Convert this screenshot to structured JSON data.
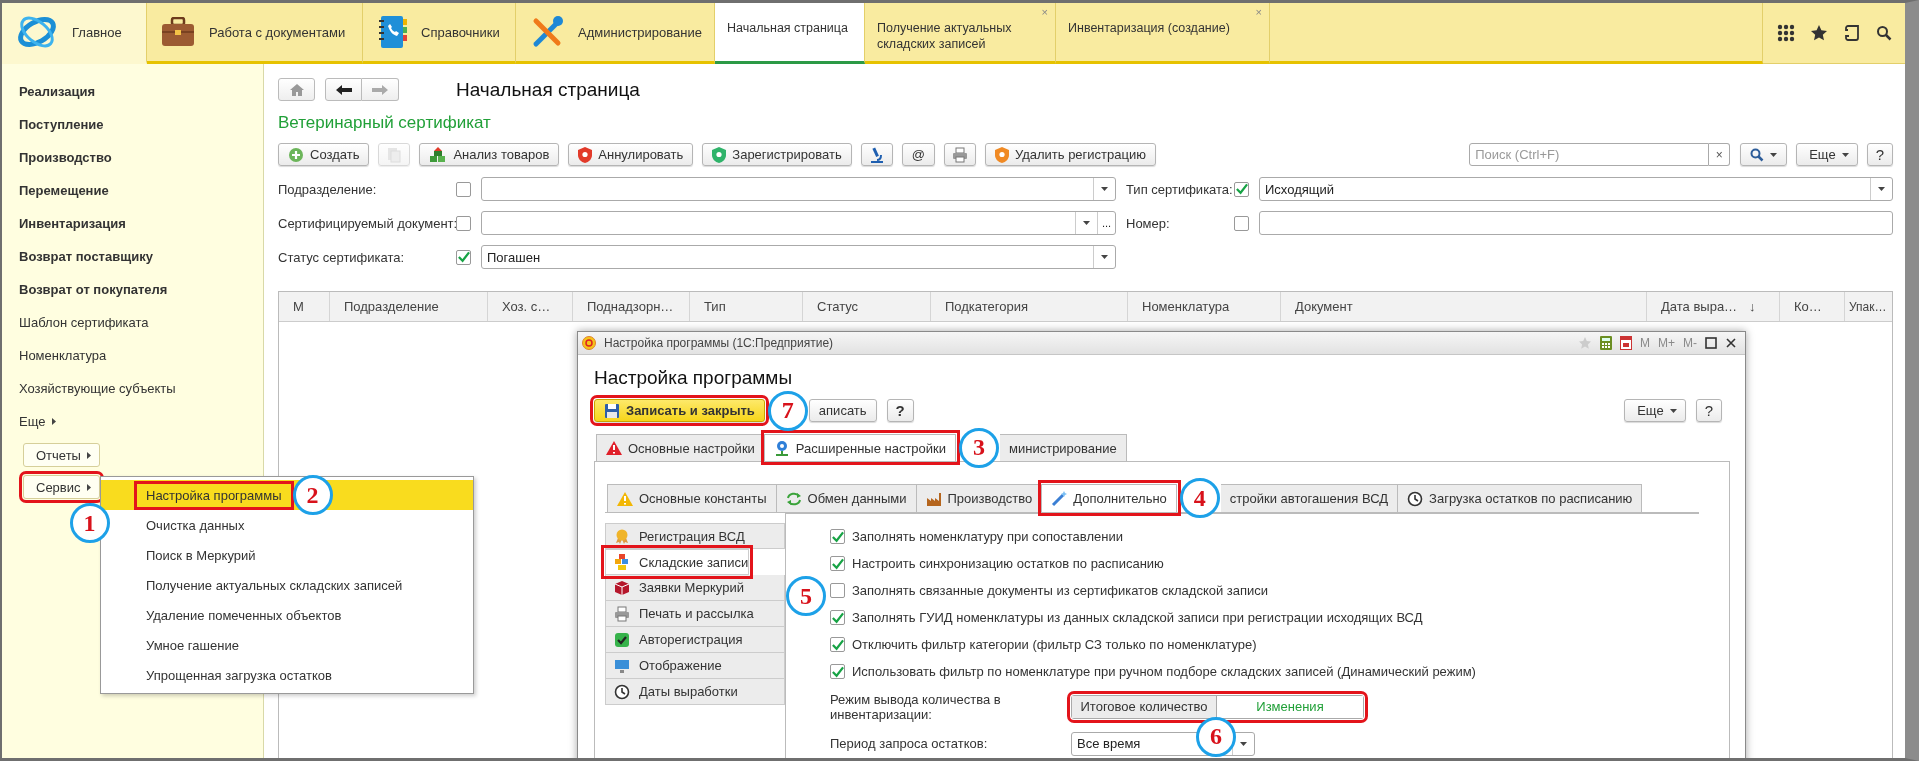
{
  "top_bar": {
    "sections": [
      {
        "label": "Главное",
        "selected": true
      },
      {
        "label": "Работа с документами",
        "selected": false
      },
      {
        "label": "Справочники",
        "selected": false
      },
      {
        "label": "Администрирование",
        "selected": false
      }
    ],
    "tabs": [
      {
        "label": "Начальная страница",
        "selected": true
      },
      {
        "label": "Получение актуальных складских записей",
        "selected": false,
        "close": "×"
      },
      {
        "label": "Инвентаризация (создание)",
        "selected": false,
        "close": "×"
      }
    ]
  },
  "sidebar": {
    "items": [
      {
        "kind": "section",
        "label": "Реализация"
      },
      {
        "kind": "section",
        "label": "Поступление"
      },
      {
        "kind": "section",
        "label": "Производство"
      },
      {
        "kind": "section",
        "label": "Перемещение"
      },
      {
        "kind": "section",
        "label": "Инвентаризация"
      },
      {
        "kind": "section",
        "label": "Возврат поставщику"
      },
      {
        "kind": "section",
        "label": "Возврат от покупателя"
      },
      {
        "kind": "link",
        "label": "Шаблон сертификата"
      },
      {
        "kind": "link",
        "label": "Номенклатура"
      },
      {
        "kind": "link",
        "label": "Хозяйствующие субъекты"
      },
      {
        "kind": "more",
        "label": "Еще"
      },
      {
        "kind": "button",
        "label": "Отчеты"
      },
      {
        "kind": "button",
        "label": "Сервис",
        "callout": "1"
      }
    ]
  },
  "service_menu": {
    "items": [
      {
        "label": "Настройка программы",
        "selected": true,
        "callout": "2"
      },
      {
        "label": "Очистка данных",
        "selected": false
      },
      {
        "label": "Поиск в Меркурий",
        "selected": false
      },
      {
        "label": "Получение актуальных складских записей",
        "selected": false
      },
      {
        "label": "Удаление помеченных объектов",
        "selected": false
      },
      {
        "label": "Умное гашение",
        "selected": false
      },
      {
        "label": "Упрощенная загрузка остатков",
        "selected": false
      }
    ]
  },
  "page": {
    "title": "Начальная страница",
    "form_title": "Ветеринарный сертификат",
    "toolbar": [
      {
        "kind": "button",
        "label": "Создать",
        "disabled": false
      },
      {
        "kind": "icon",
        "disabled": true
      },
      {
        "kind": "button",
        "label": "Анализ товаров",
        "disabled": false
      },
      {
        "kind": "button",
        "label": "Аннулировать",
        "disabled": false
      },
      {
        "kind": "button",
        "label": "Зарегистрировать",
        "disabled": false
      },
      {
        "kind": "icon",
        "disabled": false
      },
      {
        "kind": "text",
        "label": "@",
        "disabled": false
      },
      {
        "kind": "icon",
        "disabled": false
      },
      {
        "kind": "button",
        "label": "Удалить регистрацию",
        "disabled": false
      }
    ],
    "search": {
      "placeholder": "Поиск (Ctrl+F)",
      "clear": "×"
    },
    "more_button": "Еще",
    "help_button": "?",
    "filters": [
      {
        "kind": "select",
        "label": "Подразделение:",
        "checked": false
      },
      {
        "kind": "select",
        "label": "Тип сертификата:",
        "checked": true,
        "value": "Исходящий"
      },
      {
        "kind": "choice",
        "label": "Сертифицируемый документ:",
        "checked": false,
        "choice_button": "..."
      },
      {
        "kind": "text",
        "label": "Номер:",
        "checked": false
      },
      {
        "kind": "select",
        "label": "Статус сертификата:",
        "checked": true,
        "value": "Погашен"
      }
    ],
    "table": {
      "columns": [
        {
          "label": "М"
        },
        {
          "label": "Подразделение"
        },
        {
          "label": "Хоз. с…"
        },
        {
          "label": "Поднадзорн…"
        },
        {
          "label": "Тип"
        },
        {
          "label": "Статус"
        },
        {
          "label": "Подкатегория"
        },
        {
          "label": "Номенклатура"
        },
        {
          "label": "Документ"
        },
        {
          "label": "Дата выра…",
          "sort": "↓"
        },
        {
          "label": "Ко…"
        },
        {
          "label": "Упак…"
        }
      ]
    }
  },
  "dialog": {
    "title": "Настройка программы (1С:Предприятие)",
    "title_tools": [
      "M",
      "M+",
      "M-"
    ],
    "heading": "Настройка программы",
    "buttons": [
      {
        "kind": "primary",
        "label": "Записать и закрыть",
        "callout": "7"
      },
      {
        "kind": "normal",
        "label": "аписать"
      },
      {
        "kind": "normal",
        "label": "?"
      }
    ],
    "more_button": "Еще",
    "help_button": "?",
    "tabs": [
      {
        "label": "Основные настройки",
        "selected": false
      },
      {
        "label": "Расширенные настройки",
        "selected": true,
        "callout": "3"
      },
      {
        "label": "министрирование",
        "selected": false
      }
    ],
    "subtabs": [
      {
        "label": "Основные константы",
        "selected": false
      },
      {
        "label": "Обмен данными",
        "selected": false
      },
      {
        "label": "Производство",
        "selected": false
      },
      {
        "label": "Дополнительно",
        "selected": true,
        "callout": "4"
      },
      {
        "label": "стройки автогашения ВСД",
        "selected": false
      },
      {
        "label": "Загрузка остатков по расписанию",
        "selected": false
      }
    ],
    "sections": [
      {
        "label": "Регистрация ВСД",
        "selected": false
      },
      {
        "label": "Складские записи",
        "selected": true,
        "callout": "5"
      },
      {
        "label": "Заявки Меркурий",
        "selected": false
      },
      {
        "label": "Печать и рассылка",
        "selected": false
      },
      {
        "label": "Авторегистрация",
        "selected": false
      },
      {
        "label": "Отображение",
        "selected": false
      },
      {
        "label": "Даты выработки",
        "selected": false
      }
    ],
    "options": [
      {
        "label": "Заполнять номенклатуру при сопоставлении",
        "checked": true
      },
      {
        "label": "Настроить синхронизацию остатков по расписанию",
        "checked": true
      },
      {
        "label": "Заполнять связанные документы из сертификатов складской записи",
        "checked": false
      },
      {
        "label": "Заполнять ГУИД номенклатуры из данных складской записи при регистрации исходящих ВСД",
        "checked": true
      },
      {
        "label": "Отключить фильтр категории (фильтр СЗ только по номенклатуре)",
        "checked": true
      },
      {
        "label": "Использовать фильтр по номенклатуре при ручном подборе складских записей (Динамический режим)",
        "checked": true
      }
    ],
    "quantity_mode": {
      "label": "Режим вывода количества в инвентаризации:",
      "callout": "6",
      "options": [
        {
          "label": "Итоговое количество",
          "selected": false
        },
        {
          "label": "Изменения",
          "selected": true
        }
      ]
    },
    "period": {
      "label": "Период запроса остатков:",
      "value": "Все время"
    }
  }
}
